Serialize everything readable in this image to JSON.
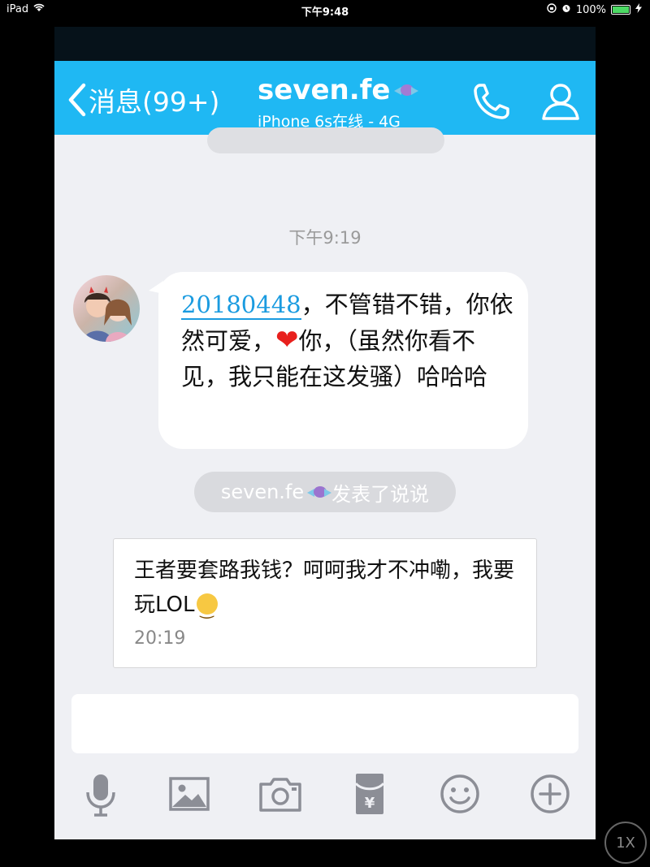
{
  "status_bar": {
    "device": "iPad",
    "time": "下午9:48",
    "battery": "100%"
  },
  "navbar": {
    "back_label": "消息(99+)",
    "title": "seven.fe",
    "subtitle": "iPhone 6s在线 - 4G",
    "accent_color": "#1fb8f3",
    "call_icon": "phone-icon",
    "profile_icon": "person-icon"
  },
  "chat": {
    "timestamp": "下午9:19",
    "message": {
      "qq_number": "20180448",
      "text_before_heart": "，不管错不错，你依然可爱，",
      "heart": "❤",
      "text_after_heart": "你，（虽然你看不见，我只能在这发骚）哈哈哈"
    },
    "system_notice": {
      "name": "seven.fe",
      "action": "发表了说说"
    },
    "post_card": {
      "text": "王者要套路我钱？呵呵我才不冲嘞，我要玩LOL",
      "time": "20:19"
    }
  },
  "input": {
    "value": ""
  },
  "toolbar": {
    "items": [
      "microphone-icon",
      "image-icon",
      "camera-icon",
      "red-packet-icon",
      "emoji-icon",
      "plus-icon"
    ]
  },
  "zoom_button": {
    "label": "1X"
  }
}
